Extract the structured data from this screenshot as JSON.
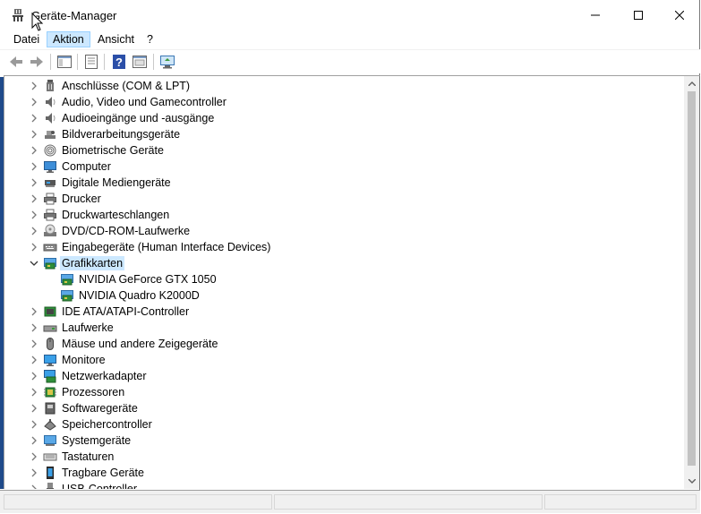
{
  "window": {
    "title": "Geräte-Manager"
  },
  "menu": {
    "items": [
      "Datei",
      "Aktion",
      "Ansicht",
      "?"
    ],
    "active_index": 1
  },
  "toolbar": {
    "buttons": [
      "back-arrow-icon",
      "forward-arrow-icon",
      "show-hide-console-tree-icon",
      "properties-icon",
      "help-icon",
      "view-icon",
      "scan-hardware-icon"
    ]
  },
  "tree": {
    "items": [
      {
        "label": "Anschlüsse (COM & LPT)",
        "icon": "port-icon",
        "level": 0,
        "expanded": false
      },
      {
        "label": "Audio, Video und Gamecontroller",
        "icon": "speaker-icon",
        "level": 0,
        "expanded": false
      },
      {
        "label": "Audioeingänge und -ausgänge",
        "icon": "speaker-icon",
        "level": 0,
        "expanded": false
      },
      {
        "label": "Bildverarbeitungsgeräte",
        "icon": "camera-icon",
        "level": 0,
        "expanded": false
      },
      {
        "label": "Biometrische Geräte",
        "icon": "fingerprint-icon",
        "level": 0,
        "expanded": false
      },
      {
        "label": "Computer",
        "icon": "computer-icon",
        "level": 0,
        "expanded": false
      },
      {
        "label": "Digitale Mediengeräte",
        "icon": "media-device-icon",
        "level": 0,
        "expanded": false
      },
      {
        "label": "Drucker",
        "icon": "printer-icon",
        "level": 0,
        "expanded": false
      },
      {
        "label": "Druckwarteschlangen",
        "icon": "printer-icon",
        "level": 0,
        "expanded": false
      },
      {
        "label": "DVD/CD-ROM-Laufwerke",
        "icon": "disc-drive-icon",
        "level": 0,
        "expanded": false
      },
      {
        "label": "Eingabegeräte (Human Interface Devices)",
        "icon": "hid-icon",
        "level": 0,
        "expanded": false
      },
      {
        "label": "Grafikkarten",
        "icon": "display-adapter-icon",
        "level": 0,
        "expanded": true,
        "selected": true
      },
      {
        "label": "NVIDIA GeForce GTX 1050",
        "icon": "display-adapter-icon",
        "level": 1
      },
      {
        "label": "NVIDIA Quadro K2000D",
        "icon": "display-adapter-icon",
        "level": 1
      },
      {
        "label": "IDE ATA/ATAPI-Controller",
        "icon": "ide-controller-icon",
        "level": 0,
        "expanded": false
      },
      {
        "label": "Laufwerke",
        "icon": "disk-drive-icon",
        "level": 0,
        "expanded": false
      },
      {
        "label": "Mäuse und andere Zeigegeräte",
        "icon": "mouse-icon",
        "level": 0,
        "expanded": false
      },
      {
        "label": "Monitore",
        "icon": "monitor-icon",
        "level": 0,
        "expanded": false
      },
      {
        "label": "Netzwerkadapter",
        "icon": "network-adapter-icon",
        "level": 0,
        "expanded": false
      },
      {
        "label": "Prozessoren",
        "icon": "processor-icon",
        "level": 0,
        "expanded": false
      },
      {
        "label": "Softwaregeräte",
        "icon": "software-device-icon",
        "level": 0,
        "expanded": false
      },
      {
        "label": "Speichercontroller",
        "icon": "storage-controller-icon",
        "level": 0,
        "expanded": false
      },
      {
        "label": "Systemgeräte",
        "icon": "system-device-icon",
        "level": 0,
        "expanded": false
      },
      {
        "label": "Tastaturen",
        "icon": "keyboard-icon",
        "level": 0,
        "expanded": false
      },
      {
        "label": "Tragbare Geräte",
        "icon": "portable-device-icon",
        "level": 0,
        "expanded": false
      },
      {
        "label": "USB-Controller",
        "icon": "usb-icon",
        "level": 0,
        "expanded": false
      }
    ]
  },
  "colors": {
    "selection": "#cce8ff",
    "selection_border": "#99d1ff",
    "accent": "#0078d7"
  }
}
